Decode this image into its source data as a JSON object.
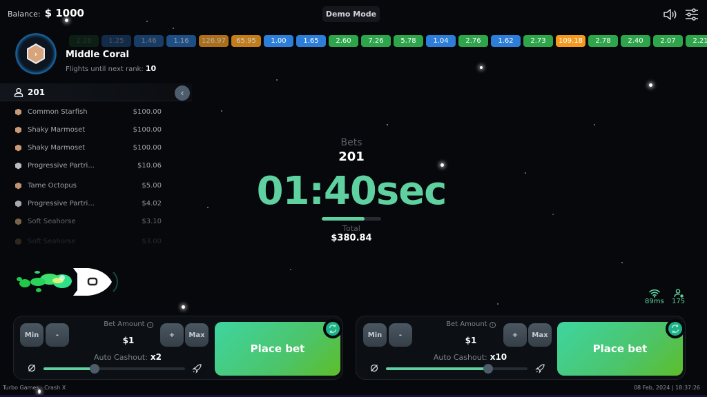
{
  "header": {
    "balance_label": "Balance:",
    "balance_value": "$ 1000",
    "mode_badge": "Demo Mode",
    "sound_icon": "speaker-icon",
    "settings_icon": "sliders-icon"
  },
  "multipliers": [
    {
      "value": "2.26",
      "color": "green",
      "faded": 0.15
    },
    {
      "value": "1.25",
      "color": "blue",
      "faded": 0.3
    },
    {
      "value": "1.46",
      "color": "blue",
      "faded": 0.45
    },
    {
      "value": "1.16",
      "color": "blue",
      "faded": 0.6
    },
    {
      "value": "126.97",
      "color": "orange",
      "faded": 0.7
    },
    {
      "value": "65.95",
      "color": "orange",
      "faded": 0.8
    },
    {
      "value": "1.00",
      "color": "blue",
      "faded": 1
    },
    {
      "value": "1.65",
      "color": "blue",
      "faded": 1
    },
    {
      "value": "2.60",
      "color": "green",
      "faded": 1
    },
    {
      "value": "7.26",
      "color": "green",
      "faded": 1
    },
    {
      "value": "5.78",
      "color": "green",
      "faded": 1
    },
    {
      "value": "1.04",
      "color": "blue",
      "faded": 1
    },
    {
      "value": "2.76",
      "color": "green",
      "faded": 1
    },
    {
      "value": "1.62",
      "color": "blue",
      "faded": 1
    },
    {
      "value": "2.73",
      "color": "green",
      "faded": 1
    },
    {
      "value": "109.18",
      "color": "orange",
      "faded": 1
    },
    {
      "value": "2.78",
      "color": "green",
      "faded": 1
    },
    {
      "value": "2.40",
      "color": "green",
      "faded": 1
    },
    {
      "value": "2.07",
      "color": "green",
      "faded": 1
    },
    {
      "value": "2.21",
      "color": "green",
      "faded": 1
    }
  ],
  "rank": {
    "name": "Middle Coral",
    "flights_label": "Flights until next rank:",
    "flights_value": "10"
  },
  "players": {
    "count": "201",
    "list": [
      {
        "name": "Common Starfish",
        "amount": "$100.00",
        "badge": "#c89a78",
        "opacity": 1
      },
      {
        "name": "Shaky Marmoset",
        "amount": "$100.00",
        "badge": "#c89a78",
        "opacity": 1
      },
      {
        "name": "Shaky Marmoset",
        "amount": "$100.00",
        "badge": "#c89a78",
        "opacity": 1
      },
      {
        "name": "Progressive Partri...",
        "amount": "$10.06",
        "badge": "#b8bcc2",
        "opacity": 1
      },
      {
        "name": "Tame Octopus",
        "amount": "$5.00",
        "badge": "#c89a78",
        "opacity": 0.95
      },
      {
        "name": "Progressive Partri...",
        "amount": "$4.02",
        "badge": "#b8bcc2",
        "opacity": 0.9
      },
      {
        "name": "Soft Seahorse",
        "amount": "$3.10",
        "badge": "#c8a070",
        "opacity": 0.6
      },
      {
        "name": "Soft Seahorse",
        "amount": "$3.00",
        "badge": "#c8a070",
        "opacity": 0.2
      }
    ]
  },
  "round": {
    "bets_label": "Bets",
    "bets_value": "201",
    "timer": "01:40sec",
    "progress_fraction": 0.72,
    "total_label": "Total",
    "total_value": "$380.84"
  },
  "stats": {
    "ping": "89ms",
    "online": "175"
  },
  "bet_panels": [
    {
      "min_label": "Min",
      "minus_label": "-",
      "plus_label": "+",
      "max_label": "Max",
      "bet_label": "Bet Amount",
      "bet_value": "$1",
      "cashout_label": "Auto Cashout:",
      "cashout_value": "x2",
      "slider_fraction": 0.36,
      "place_label": "Place bet"
    },
    {
      "min_label": "Min",
      "minus_label": "-",
      "plus_label": "+",
      "max_label": "Max",
      "bet_label": "Bet Amount",
      "bet_value": "$1",
      "cashout_label": "Auto Cashout:",
      "cashout_value": "x10",
      "slider_fraction": 0.72,
      "place_label": "Place bet"
    }
  ],
  "footer": {
    "brand": "Turbo Games · Crash X",
    "datetime": "08 Feb, 2024 | 18:37:26"
  }
}
